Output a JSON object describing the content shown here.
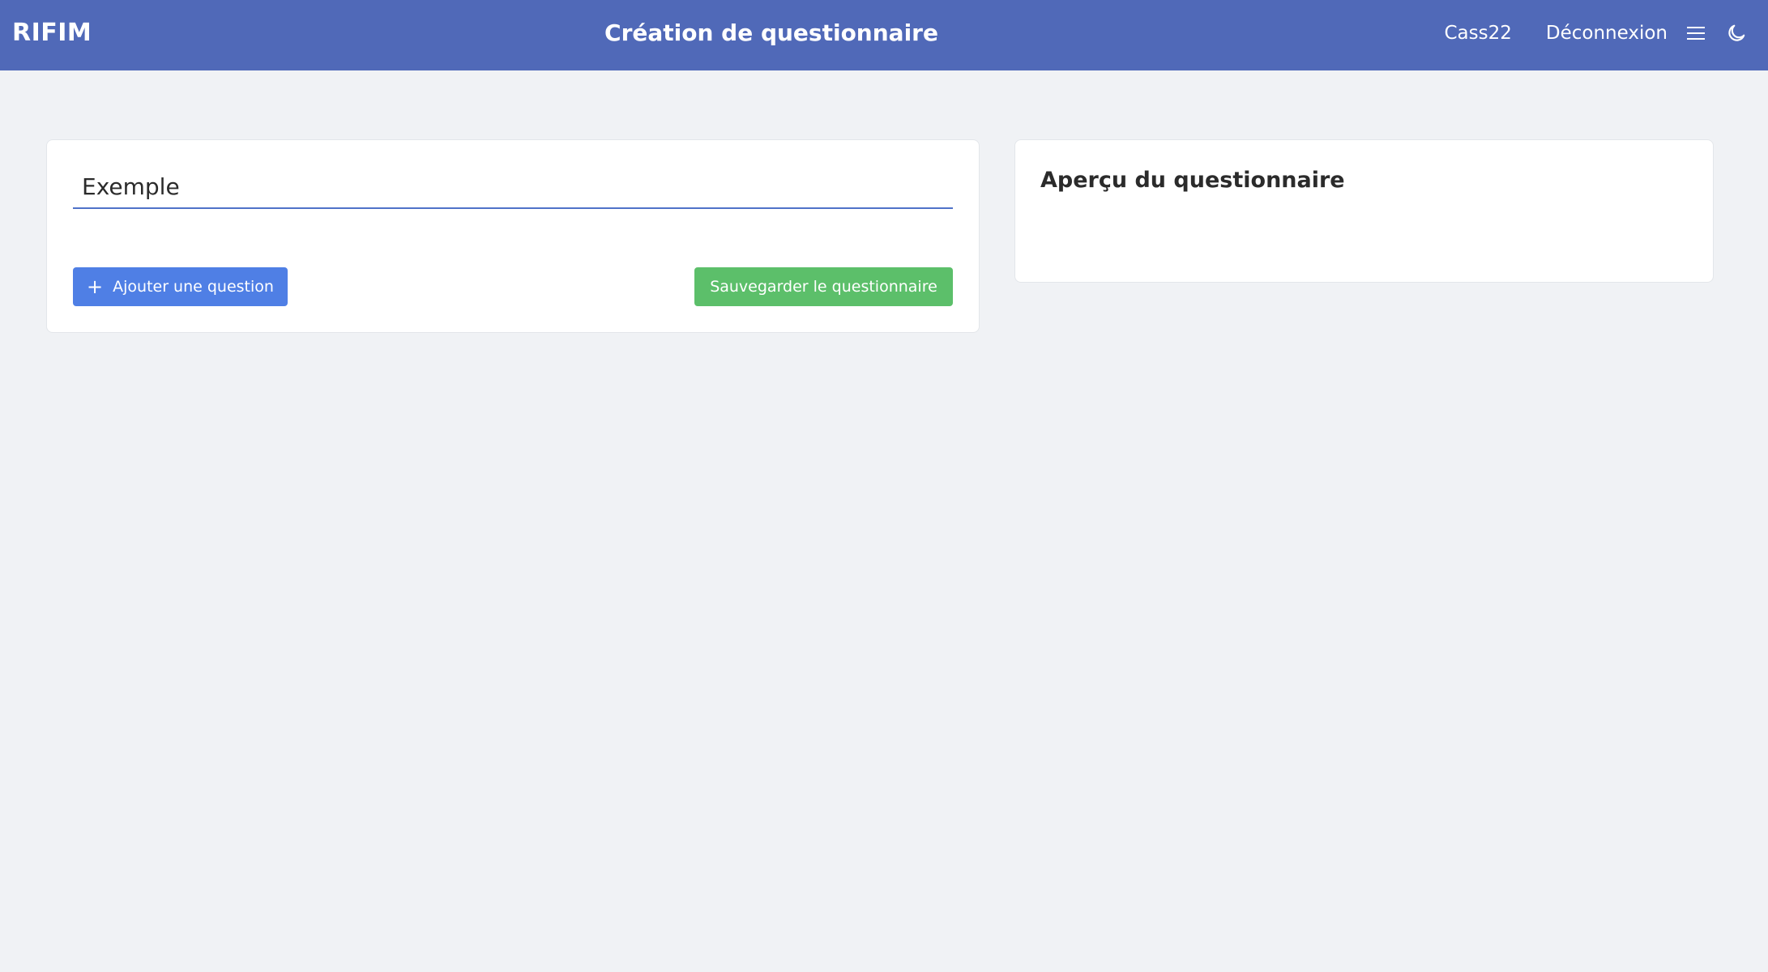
{
  "header": {
    "brand": "RIFIM",
    "title": "Création de questionnaire",
    "username": "Cass22",
    "logout_label": "Déconnexion",
    "menu_icon": "hamburger-menu-icon",
    "theme_icon": "moon-icon"
  },
  "editor": {
    "title_value": "Exemple",
    "add_question_label": "Ajouter une question",
    "add_question_icon": "plus-icon",
    "save_label": "Sauvegarder le questionnaire"
  },
  "preview": {
    "title": "Aperçu du questionnaire"
  },
  "colors": {
    "navbar": "#5069b8",
    "background": "#f0f2f5",
    "primary_button": "#4f7fe5",
    "success_button": "#5cbf6a",
    "input_underline": "#4f72c8"
  }
}
